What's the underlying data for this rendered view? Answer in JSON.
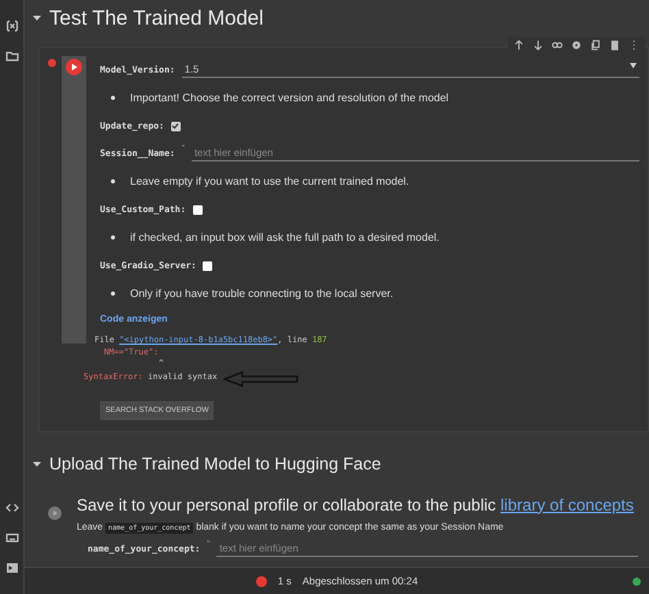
{
  "section_1": {
    "title": "Test The Trained Model",
    "expanded": true
  },
  "cell_1": {
    "failed": true,
    "fields": [
      {
        "kind": "dropdown",
        "label": "Model_Version:",
        "value": "1.5"
      },
      {
        "kind": "note",
        "text": "Important! Choose the correct version and resolution of the model"
      },
      {
        "kind": "checkbox",
        "label": "Update_repo:",
        "checked": true
      },
      {
        "kind": "text",
        "label": "Session__Name:",
        "quote": "\"",
        "placeholder": "text hier einfügen"
      },
      {
        "kind": "note",
        "text": "Leave empty if you want to use the current trained model."
      },
      {
        "kind": "checkbox",
        "label": "Use_Custom_Path:",
        "checked": false
      },
      {
        "kind": "note",
        "text": "if checked, an input box will ask the full path to a desired model."
      },
      {
        "kind": "checkbox",
        "label": "Use_Gradio_Server:",
        "checked": false
      },
      {
        "kind": "note",
        "text": "Only if you have trouble connecting to the local server."
      }
    ],
    "show_code": "Code anzeigen",
    "traceback": {
      "file_prefix": "File ",
      "file_link": "\"<ipython-input-8-b1a5bc118eb8>\"",
      "line_prefix": ", line ",
      "line_number": "187",
      "code_line": "NM==\"True\":",
      "caret": "^",
      "error_type": "SyntaxError:",
      "error_message": "invalid syntax"
    },
    "search_button": "SEARCH STACK OVERFLOW"
  },
  "section_2": {
    "title": "Upload The Trained Model to Hugging Face",
    "expanded": true
  },
  "cell_2": {
    "failed": false,
    "heading": "Save it to your personal profile or collaborate to the public ",
    "heading_link": "library of concepts",
    "description_before": "Leave ",
    "description_code": "name_of_your_concept",
    "description_after": " blank if you want to name your concept the same as your Session Name",
    "fields": [
      {
        "kind": "text",
        "label": "name_of_your_concept:",
        "quote": "\"",
        "placeholder": "text hier einfügen"
      }
    ]
  },
  "status_bar": {
    "failed": true,
    "duration": "1 s",
    "message": "Abgeschlossen um 00:24",
    "connected": true
  }
}
